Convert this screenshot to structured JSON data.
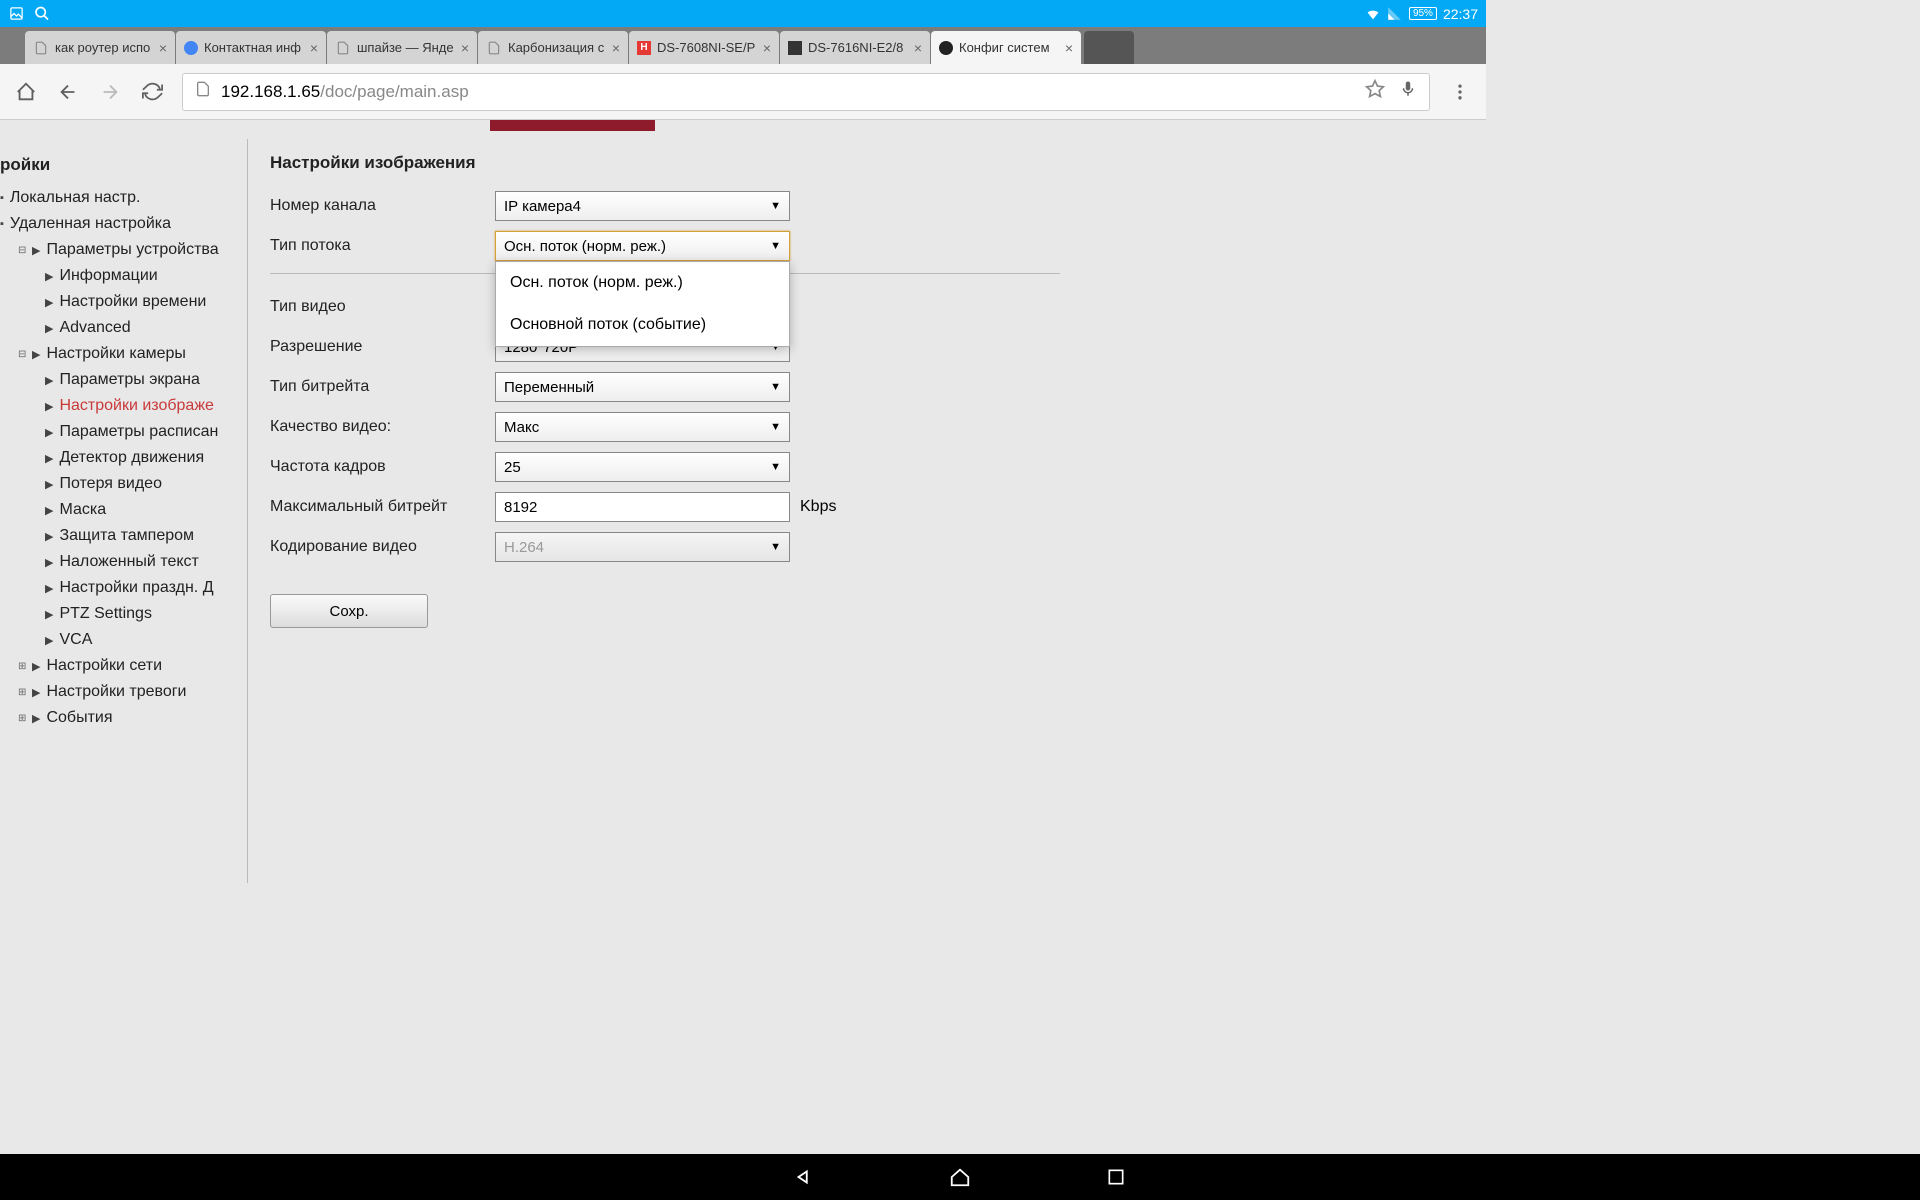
{
  "status": {
    "battery": "95%",
    "time": "22:37"
  },
  "tabs": [
    {
      "title": "как роутер испо",
      "favicon": "doc"
    },
    {
      "title": "Контактная инф",
      "favicon": "blue"
    },
    {
      "title": "шпайзе — Янде",
      "favicon": "doc"
    },
    {
      "title": "Карбонизация с",
      "favicon": "doc"
    },
    {
      "title": "DS-7608NI-SE/P",
      "favicon": "red"
    },
    {
      "title": "DS-7616NI-E2/8",
      "favicon": "dark"
    },
    {
      "title": "Конфиг систем",
      "favicon": "cam",
      "active": true
    }
  ],
  "url": {
    "host": "192.168.1.65",
    "path": "/doc/page/main.asp"
  },
  "sidebar": {
    "title": "ройки",
    "items": [
      {
        "label": "Локальная настр.",
        "level": 1
      },
      {
        "label": "Удаленная настройка",
        "level": 1
      },
      {
        "label": "Параметры устройства",
        "level": 2
      },
      {
        "label": "Информации",
        "level": 3
      },
      {
        "label": "Настройки времени",
        "level": 3
      },
      {
        "label": "Advanced",
        "level": 3
      },
      {
        "label": "Настройки камеры",
        "level": 2
      },
      {
        "label": "Параметры экрана",
        "level": 3
      },
      {
        "label": "Настройки изображе",
        "level": 3,
        "selected": true
      },
      {
        "label": "Параметры расписан",
        "level": 3
      },
      {
        "label": "Детектор движения",
        "level": 3
      },
      {
        "label": "Потеря видео",
        "level": 3
      },
      {
        "label": "Маска",
        "level": 3
      },
      {
        "label": "Защита тампером",
        "level": 3
      },
      {
        "label": "Наложенный текст",
        "level": 3
      },
      {
        "label": "Настройки праздн. Д",
        "level": 3
      },
      {
        "label": "PTZ Settings",
        "level": 3
      },
      {
        "label": "VCA",
        "level": 3
      },
      {
        "label": "Настройки сети",
        "level": 2
      },
      {
        "label": "Настройки тревоги",
        "level": 2
      },
      {
        "label": "События",
        "level": 2
      }
    ]
  },
  "panel": {
    "title": "Настройки изображения",
    "channel_label": "Номер канала",
    "channel_value": "IP камера4",
    "stream_label": "Тип потока",
    "stream_value": "Осн. поток (норм. реж.)",
    "stream_options": [
      "Осн. поток (норм. реж.)",
      "Основной поток (событие)"
    ],
    "video_type_label": "Тип видео",
    "resolution_label": "Разрешение",
    "resolution_value": "1280*720P",
    "bitrate_type_label": "Тип битрейта",
    "bitrate_type_value": "Переменный",
    "quality_label": "Качество видео:",
    "quality_value": "Макс",
    "fps_label": "Частота кадров",
    "fps_value": "25",
    "max_bitrate_label": "Максимальный битрейт",
    "max_bitrate_value": "8192",
    "max_bitrate_unit": "Kbps",
    "encoding_label": "Кодирование видео",
    "encoding_value": "H.264",
    "save": "Сохр."
  }
}
